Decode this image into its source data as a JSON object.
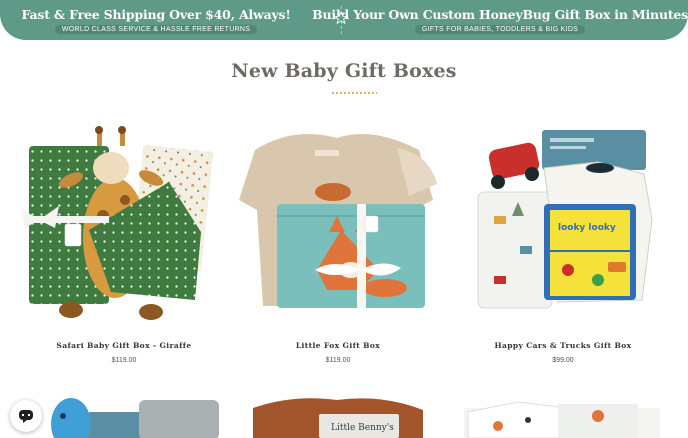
{
  "promo_bar": {
    "left_title": "Fast & Free Shipping Over $40, Always!",
    "left_sub": "WORLD CLASS SERVICE & HASSLE FREE RETURNS",
    "right_title": "Build Your Own Custom HoneyBug Gift Box in Minutes",
    "right_sub": "GIFTS FOR BABIES, TODDLERS & BIG KIDS",
    "bg_color": "#5e9a87"
  },
  "section": {
    "title": "New Baby Gift Boxes",
    "accent_color": "#e3ae3c"
  },
  "products": [
    {
      "name": "Safari Baby Gift Box - Giraffe",
      "price": "$119.00",
      "icon": "giraffe-gift-box-image"
    },
    {
      "name": "Little Fox Gift Box",
      "price": "$119.00",
      "icon": "fox-gift-box-image"
    },
    {
      "name": "Happy Cars & Trucks Gift Box",
      "price": "$99.00",
      "icon": "cars-trucks-gift-box-image"
    }
  ],
  "products_row2": [
    {
      "icon": "dinosaur-gift-box-image"
    },
    {
      "book_title": "Little Benny's",
      "icon": "book-gift-box-image"
    },
    {
      "icon": "onesie-gift-box-image"
    }
  ],
  "chat": {
    "icon": "chat-icon"
  }
}
